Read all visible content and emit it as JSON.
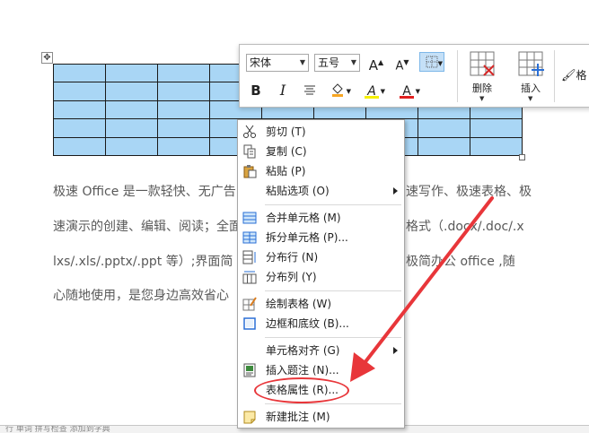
{
  "toolbar": {
    "font_name": "宋体",
    "font_size": "五号",
    "grow_font_label": "A",
    "shrink_font_label": "A",
    "bold_label": "B",
    "italic_label": "I",
    "font_color_label": "A",
    "highlight_label": "A",
    "delete_label": "删除",
    "insert_label": "插入",
    "format_brush_label": "格",
    "colors": {
      "font_color": "#e02020",
      "highlight": "#f5f000",
      "fill": "#f7a623"
    }
  },
  "document": {
    "paragraph_lines": [
      "极速 Office 是一款轻快、无广告",
      "速演示的创建、编辑、阅读；全面",
      "lxs/.xls/.pptx/.ppt 等）;界面简",
      "心随地使用，是您身边高效省心"
    ],
    "paragraph_right_fragments": [
      "速写作、极速表格、极",
      "格式（.docx/.doc/.x",
      "极简办公 office ,随",
      ""
    ],
    "table_fill": "#a9d6f5",
    "statusbar_text": "行 单词      拼写检查      添加到字典"
  },
  "context_menu": {
    "items": [
      {
        "label": "剪切 (T)",
        "icon": "scissors-icon",
        "has_submenu": false
      },
      {
        "label": "复制 (C)",
        "icon": "copy-icon",
        "has_submenu": false
      },
      {
        "label": "粘贴 (P)",
        "icon": "paste-icon",
        "has_submenu": false
      },
      {
        "label": "粘贴选项 (O)",
        "icon": "",
        "has_submenu": true
      },
      {
        "label": "合并单元格 (M)",
        "icon": "merge-cells-icon",
        "has_submenu": false
      },
      {
        "label": "拆分单元格 (P)...",
        "icon": "split-cells-icon",
        "has_submenu": false
      },
      {
        "label": "分布行 (N)",
        "icon": "distribute-rows-icon",
        "has_submenu": false
      },
      {
        "label": "分布列 (Y)",
        "icon": "distribute-columns-icon",
        "has_submenu": false
      },
      {
        "label": "绘制表格 (W)",
        "icon": "draw-table-icon",
        "has_submenu": false
      },
      {
        "label": "边框和底纹 (B)...",
        "icon": "borders-shading-icon",
        "has_submenu": false
      },
      {
        "label": "单元格对齐 (G)",
        "icon": "",
        "has_submenu": true
      },
      {
        "label": "插入题注 (N)...",
        "icon": "insert-caption-icon",
        "has_submenu": false
      },
      {
        "label": "表格属性 (R)...",
        "icon": "",
        "has_submenu": false
      },
      {
        "label": "新建批注 (M)",
        "icon": "new-comment-icon",
        "has_submenu": false
      }
    ]
  },
  "annotation": {
    "color": "#e8363a",
    "highlighted_item": "表格属性 (R)..."
  }
}
